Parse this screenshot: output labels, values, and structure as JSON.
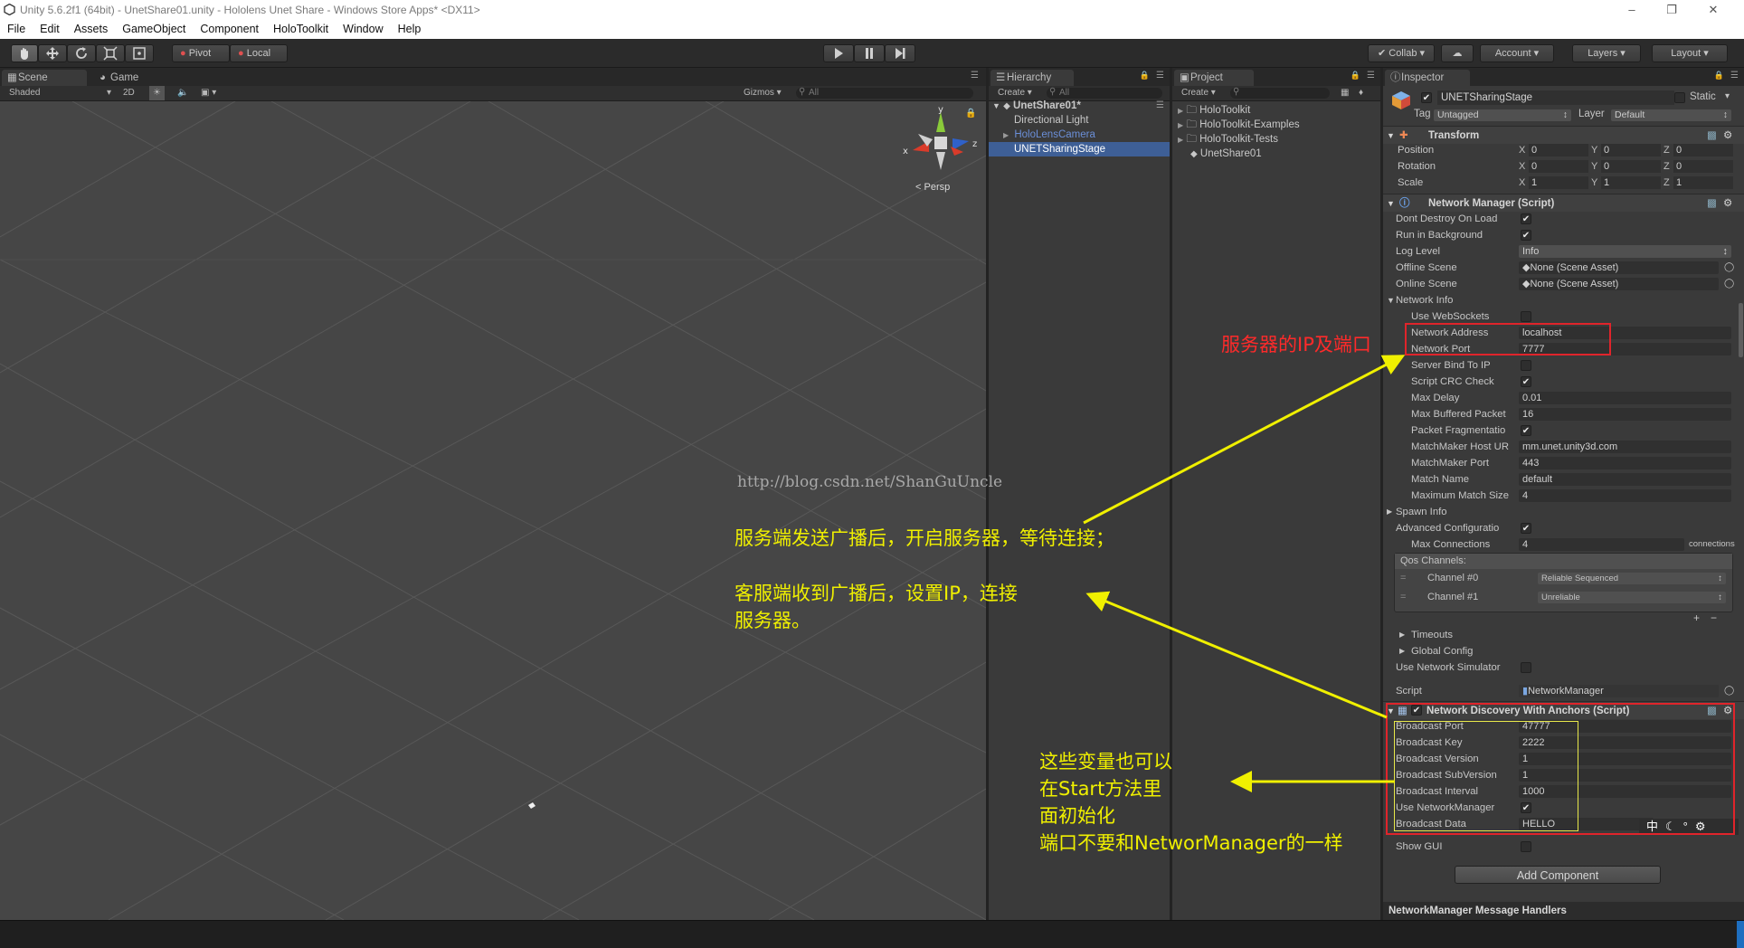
{
  "window": {
    "title": "Unity 5.6.2f1 (64bit) - UnetShare01.unity - Hololens Unet Share - Windows Store Apps* <DX11>"
  },
  "menu": [
    "File",
    "Edit",
    "Assets",
    "GameObject",
    "Component",
    "HoloToolkit",
    "Window",
    "Help"
  ],
  "toolbar": {
    "pivot": "Pivot",
    "local": "Local",
    "collab": "Collab",
    "account": "Account",
    "layers": "Layers",
    "layout": "Layout"
  },
  "scene": {
    "tab_scene": "Scene",
    "tab_game": "Game",
    "shading": "Shaded",
    "mode_2d": "2D",
    "gizmos": "Gizmos",
    "search_placeholder": "All",
    "persp": "Persp",
    "gizmo_axes": {
      "y": "y",
      "x": "x",
      "z": "z"
    }
  },
  "hierarchy": {
    "tab": "Hierarchy",
    "create": "Create",
    "search_placeholder": "All",
    "scene_name": "UnetShare01*",
    "items": [
      "Directional Light",
      "HoloLensCamera",
      "UNETSharingStage"
    ]
  },
  "project": {
    "tab": "Project",
    "create": "Create",
    "items": [
      "HoloToolkit",
      "HoloToolkit-Examples",
      "HoloToolkit-Tests",
      "UnetShare01"
    ]
  },
  "inspector": {
    "tab": "Inspector",
    "object_name": "UNETSharingStage",
    "static_label": "Static",
    "tag_label": "Tag",
    "tag_value": "Untagged",
    "layer_label": "Layer",
    "layer_value": "Default",
    "transform": {
      "title": "Transform",
      "rows": [
        {
          "label": "Position",
          "x": "0",
          "y": "0",
          "z": "0"
        },
        {
          "label": "Rotation",
          "x": "0",
          "y": "0",
          "z": "0"
        },
        {
          "label": "Scale",
          "x": "1",
          "y": "1",
          "z": "1"
        }
      ]
    },
    "network_manager": {
      "title": "Network Manager (Script)",
      "dont_destroy": "Dont Destroy On Load",
      "run_in_bg": "Run in Background",
      "log_level": "Log Level",
      "log_level_value": "Info",
      "offline_scene": "Offline Scene",
      "offline_scene_value": "None (Scene Asset)",
      "online_scene": "Online Scene",
      "online_scene_value": "None (Scene Asset)",
      "network_info": "Network Info",
      "use_websockets": "Use WebSockets",
      "network_address": "Network Address",
      "network_address_value": "localhost",
      "network_port": "Network Port",
      "network_port_value": "7777",
      "server_bind": "Server Bind To IP",
      "script_crc": "Script CRC Check",
      "max_delay": "Max Delay",
      "max_delay_value": "0.01",
      "max_buffered": "Max Buffered Packet",
      "max_buffered_value": "16",
      "packet_frag": "Packet Fragmentatio",
      "mm_host": "MatchMaker Host UR",
      "mm_host_value": "mm.unet.unity3d.com",
      "mm_port": "MatchMaker Port",
      "mm_port_value": "443",
      "match_name": "Match Name",
      "match_name_value": "default",
      "max_match_size": "Maximum Match Size",
      "max_match_size_value": "4",
      "spawn_info": "Spawn Info",
      "advanced_config": "Advanced Configuratio",
      "max_connections": "Max Connections",
      "max_connections_value": "4",
      "connections_unit": "connections",
      "qos_channels": "Qos Channels:",
      "channel0": "Channel #0",
      "channel0_value": "Reliable Sequenced",
      "channel1": "Channel #1",
      "channel1_value": "Unreliable",
      "timeouts": "Timeouts",
      "global_config": "Global Config",
      "use_net_sim": "Use Network Simulator",
      "script_label": "Script",
      "script_value": "NetworkManager"
    },
    "discovery": {
      "title": "Network Discovery With Anchors (Script)",
      "rows": [
        {
          "label": "Broadcast Port",
          "value": "47777"
        },
        {
          "label": "Broadcast Key",
          "value": "2222"
        },
        {
          "label": "Broadcast Version",
          "value": "1"
        },
        {
          "label": "Broadcast SubVersion",
          "value": "1"
        },
        {
          "label": "Broadcast Interval",
          "value": "1000"
        }
      ],
      "use_network_manager": "Use NetworkManager",
      "broadcast_data": "Broadcast Data",
      "broadcast_data_value": "HELLO",
      "show_gui": "Show GUI"
    },
    "add_component": "Add Component",
    "message_handlers": "NetworkManager Message Handlers"
  },
  "annotations": {
    "ip_port": "服务器的IP及端口",
    "server_line": "服务端发送广播后，开启服务器，等待连接；",
    "client_line1": "客服端收到广播后，设置IP，连接",
    "client_line2": "服务器。",
    "vars_line1": "这些变量也可以",
    "vars_line2": "在Start方法里",
    "vars_line3": "面初始化",
    "vars_line4": "端口不要和NetworManager的一样",
    "watermark": "http://blog.csdn.net/ShanGuUncle",
    "ime_glyph": "中"
  },
  "colors": {
    "annotation_yellow": "#f0f000",
    "annotation_red": "#ff2a2a",
    "selection_blue": "#3e5f96"
  }
}
